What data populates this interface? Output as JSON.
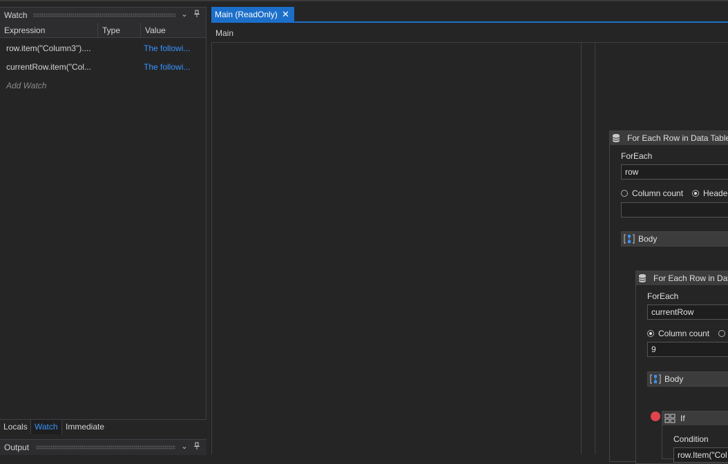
{
  "watch_panel": {
    "title": "Watch",
    "columns": [
      "Expression",
      "Type",
      "Value"
    ],
    "rows": [
      {
        "expression": "row.item(\"Column3\")....",
        "type": "",
        "value": "The followi..."
      },
      {
        "expression": "currentRow.item(\"Col...",
        "type": "",
        "value": "The followi..."
      }
    ],
    "add_watch": "Add Watch",
    "pin_icon": "pin-icon",
    "dropdown_icon": "chevron-down-icon"
  },
  "bottom_tabs": [
    {
      "label": "Locals",
      "active": false
    },
    {
      "label": "Watch",
      "active": true
    },
    {
      "label": "Immediate",
      "active": false
    }
  ],
  "output_panel": {
    "title": "Output"
  },
  "document_tab": {
    "label": "Main (ReadOnly)",
    "close_icon": "close-icon"
  },
  "breadcrumb": "Main",
  "outer_foreach": {
    "title": "For Each Row in Data Table",
    "foreach_label": "ForEach",
    "foreach_value": "row",
    "option_column_count": "Column count",
    "option_header": "Header",
    "selected_option": "Header",
    "extra_value": "",
    "body_label": "Body"
  },
  "inner_foreach": {
    "title": "For Each Row in Data",
    "foreach_label": "ForEach",
    "foreach_value": "currentRow",
    "option_column_count": "Column count",
    "selected_option": "Column count",
    "column_count_value": "9",
    "body_label": "Body"
  },
  "if_activity": {
    "title": "If",
    "condition_label": "Condition",
    "condition_value": "row.Item(\"Col"
  },
  "colors": {
    "accent": "#1c6fc9",
    "link": "#3794ff",
    "breakpoint": "#e0444e",
    "background": "#252526"
  }
}
